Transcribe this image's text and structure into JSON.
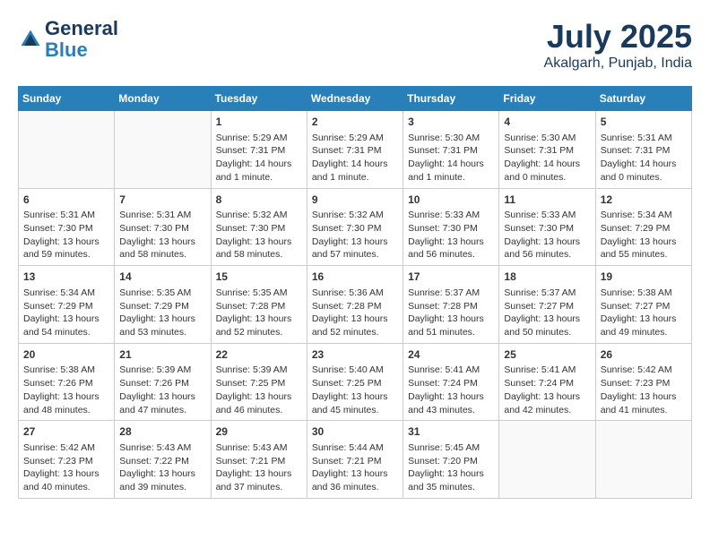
{
  "header": {
    "logo_line1": "General",
    "logo_line2": "Blue",
    "month": "July 2025",
    "location": "Akalgarh, Punjab, India"
  },
  "days_of_week": [
    "Sunday",
    "Monday",
    "Tuesday",
    "Wednesday",
    "Thursday",
    "Friday",
    "Saturday"
  ],
  "weeks": [
    [
      {
        "day": "",
        "content": ""
      },
      {
        "day": "",
        "content": ""
      },
      {
        "day": "1",
        "content": "Sunrise: 5:29 AM\nSunset: 7:31 PM\nDaylight: 14 hours and 1 minute."
      },
      {
        "day": "2",
        "content": "Sunrise: 5:29 AM\nSunset: 7:31 PM\nDaylight: 14 hours and 1 minute."
      },
      {
        "day": "3",
        "content": "Sunrise: 5:30 AM\nSunset: 7:31 PM\nDaylight: 14 hours and 1 minute."
      },
      {
        "day": "4",
        "content": "Sunrise: 5:30 AM\nSunset: 7:31 PM\nDaylight: 14 hours and 0 minutes."
      },
      {
        "day": "5",
        "content": "Sunrise: 5:31 AM\nSunset: 7:31 PM\nDaylight: 14 hours and 0 minutes."
      }
    ],
    [
      {
        "day": "6",
        "content": "Sunrise: 5:31 AM\nSunset: 7:30 PM\nDaylight: 13 hours and 59 minutes."
      },
      {
        "day": "7",
        "content": "Sunrise: 5:31 AM\nSunset: 7:30 PM\nDaylight: 13 hours and 58 minutes."
      },
      {
        "day": "8",
        "content": "Sunrise: 5:32 AM\nSunset: 7:30 PM\nDaylight: 13 hours and 58 minutes."
      },
      {
        "day": "9",
        "content": "Sunrise: 5:32 AM\nSunset: 7:30 PM\nDaylight: 13 hours and 57 minutes."
      },
      {
        "day": "10",
        "content": "Sunrise: 5:33 AM\nSunset: 7:30 PM\nDaylight: 13 hours and 56 minutes."
      },
      {
        "day": "11",
        "content": "Sunrise: 5:33 AM\nSunset: 7:30 PM\nDaylight: 13 hours and 56 minutes."
      },
      {
        "day": "12",
        "content": "Sunrise: 5:34 AM\nSunset: 7:29 PM\nDaylight: 13 hours and 55 minutes."
      }
    ],
    [
      {
        "day": "13",
        "content": "Sunrise: 5:34 AM\nSunset: 7:29 PM\nDaylight: 13 hours and 54 minutes."
      },
      {
        "day": "14",
        "content": "Sunrise: 5:35 AM\nSunset: 7:29 PM\nDaylight: 13 hours and 53 minutes."
      },
      {
        "day": "15",
        "content": "Sunrise: 5:35 AM\nSunset: 7:28 PM\nDaylight: 13 hours and 52 minutes."
      },
      {
        "day": "16",
        "content": "Sunrise: 5:36 AM\nSunset: 7:28 PM\nDaylight: 13 hours and 52 minutes."
      },
      {
        "day": "17",
        "content": "Sunrise: 5:37 AM\nSunset: 7:28 PM\nDaylight: 13 hours and 51 minutes."
      },
      {
        "day": "18",
        "content": "Sunrise: 5:37 AM\nSunset: 7:27 PM\nDaylight: 13 hours and 50 minutes."
      },
      {
        "day": "19",
        "content": "Sunrise: 5:38 AM\nSunset: 7:27 PM\nDaylight: 13 hours and 49 minutes."
      }
    ],
    [
      {
        "day": "20",
        "content": "Sunrise: 5:38 AM\nSunset: 7:26 PM\nDaylight: 13 hours and 48 minutes."
      },
      {
        "day": "21",
        "content": "Sunrise: 5:39 AM\nSunset: 7:26 PM\nDaylight: 13 hours and 47 minutes."
      },
      {
        "day": "22",
        "content": "Sunrise: 5:39 AM\nSunset: 7:25 PM\nDaylight: 13 hours and 46 minutes."
      },
      {
        "day": "23",
        "content": "Sunrise: 5:40 AM\nSunset: 7:25 PM\nDaylight: 13 hours and 45 minutes."
      },
      {
        "day": "24",
        "content": "Sunrise: 5:41 AM\nSunset: 7:24 PM\nDaylight: 13 hours and 43 minutes."
      },
      {
        "day": "25",
        "content": "Sunrise: 5:41 AM\nSunset: 7:24 PM\nDaylight: 13 hours and 42 minutes."
      },
      {
        "day": "26",
        "content": "Sunrise: 5:42 AM\nSunset: 7:23 PM\nDaylight: 13 hours and 41 minutes."
      }
    ],
    [
      {
        "day": "27",
        "content": "Sunrise: 5:42 AM\nSunset: 7:23 PM\nDaylight: 13 hours and 40 minutes."
      },
      {
        "day": "28",
        "content": "Sunrise: 5:43 AM\nSunset: 7:22 PM\nDaylight: 13 hours and 39 minutes."
      },
      {
        "day": "29",
        "content": "Sunrise: 5:43 AM\nSunset: 7:21 PM\nDaylight: 13 hours and 37 minutes."
      },
      {
        "day": "30",
        "content": "Sunrise: 5:44 AM\nSunset: 7:21 PM\nDaylight: 13 hours and 36 minutes."
      },
      {
        "day": "31",
        "content": "Sunrise: 5:45 AM\nSunset: 7:20 PM\nDaylight: 13 hours and 35 minutes."
      },
      {
        "day": "",
        "content": ""
      },
      {
        "day": "",
        "content": ""
      }
    ]
  ]
}
